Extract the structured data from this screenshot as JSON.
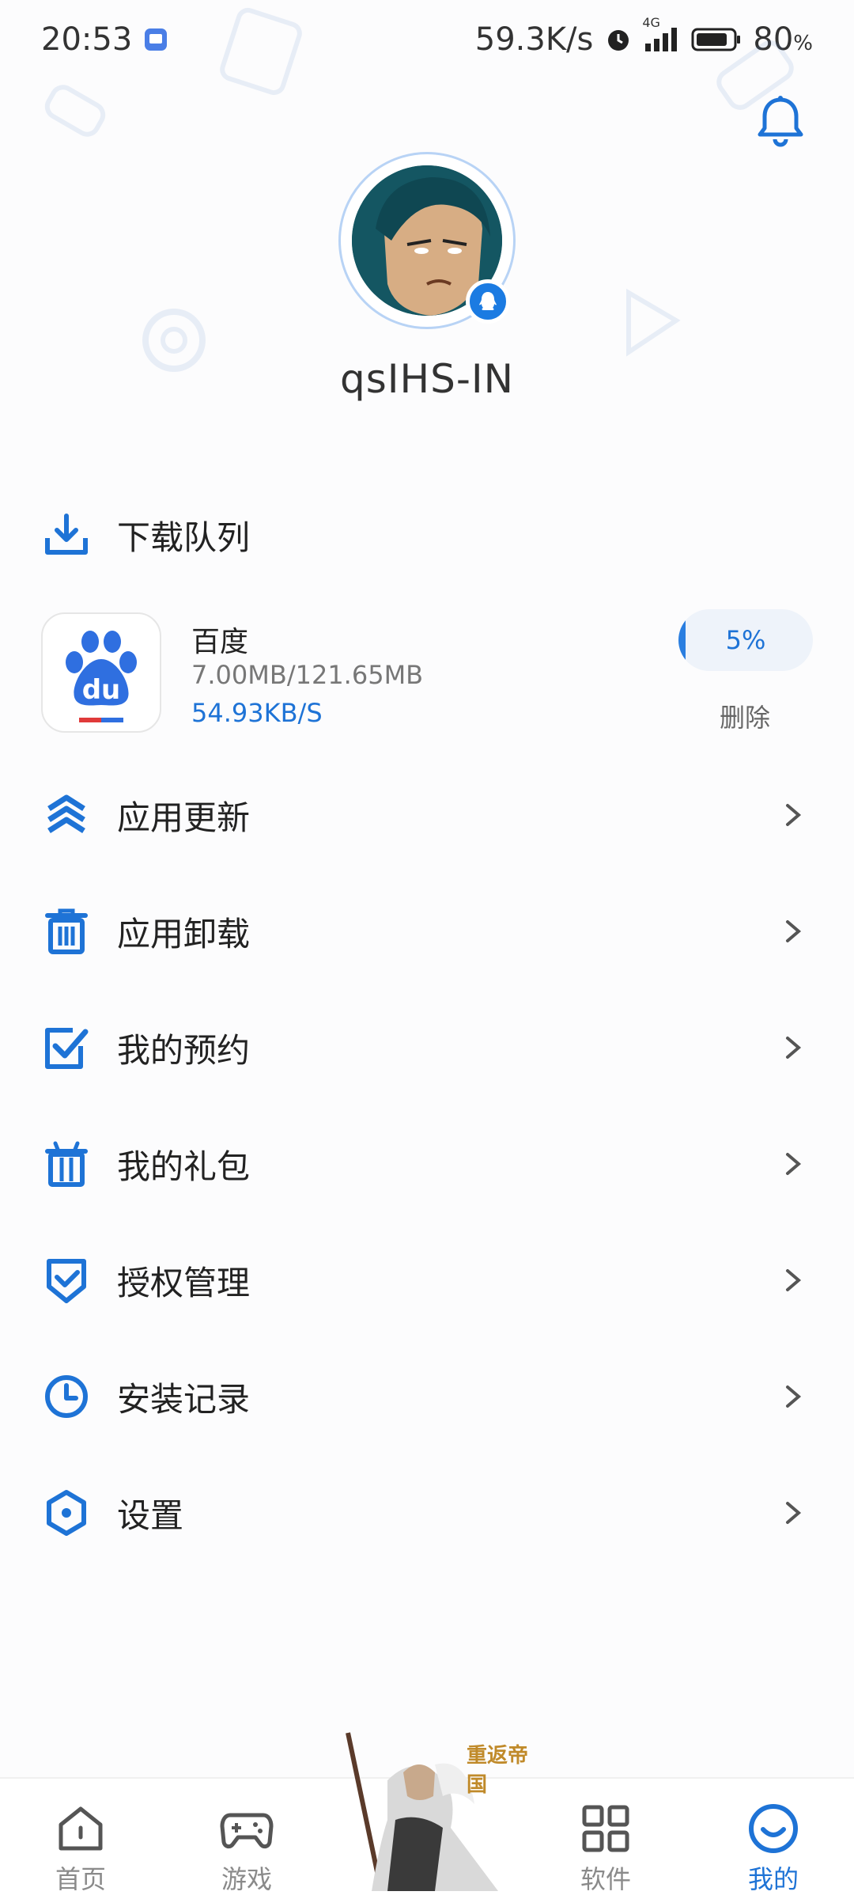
{
  "status_bar": {
    "time": "20:53",
    "net_speed": "59.3K/s",
    "network": "4G",
    "battery_pct": "80",
    "pct_symbol": "%"
  },
  "profile": {
    "username": "qsIHS-IN"
  },
  "download_queue": {
    "label": "下载队列",
    "item": {
      "app_name": "百度",
      "size": "7.00MB/121.65MB",
      "speed": "54.93KB/S",
      "progress": 0.05,
      "progress_label": "5%",
      "delete_label": "删除"
    }
  },
  "menu": [
    {
      "label": "应用更新",
      "icon": "chevrons-up-icon"
    },
    {
      "label": "应用卸载",
      "icon": "trash-icon"
    },
    {
      "label": "我的预约",
      "icon": "checkbox-icon"
    },
    {
      "label": "我的礼包",
      "icon": "gift-icon"
    },
    {
      "label": "授权管理",
      "icon": "shield-check-icon"
    },
    {
      "label": "安装记录",
      "icon": "clock-icon"
    },
    {
      "label": "设置",
      "icon": "settings-hexagon-icon"
    }
  ],
  "promo": {
    "title": "重返帝国"
  },
  "bottom_nav": [
    {
      "label": "首页",
      "icon": "home-icon"
    },
    {
      "label": "游戏",
      "icon": "gamepad-icon"
    },
    {
      "label": "软件",
      "icon": "grid-icon"
    },
    {
      "label": "我的",
      "icon": "smile-icon",
      "active": true
    }
  ],
  "colors": {
    "accent": "#1e73d6",
    "background": "#fcfcfd"
  }
}
